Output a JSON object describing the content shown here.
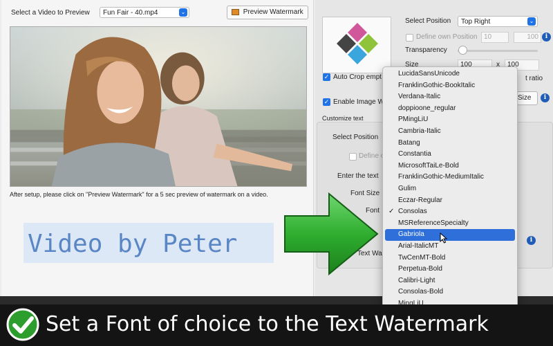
{
  "left_panel": {
    "select_video_label": "Select a Video to Preview",
    "video_file": "Fun Fair - 40.mp4",
    "preview_button": "Preview Watermark",
    "hint": "After setup, please click on \"Preview Watermark\" for a 5 sec preview of watermark on a video.",
    "watermark_text": "Video by Peter"
  },
  "image_settings": {
    "select_position_label": "Select Position",
    "position_value": "Top Right",
    "define_own_label": "Define own Position",
    "pos_x": "10",
    "pos_y": "100",
    "transparency_label": "Transparency",
    "transparency_value": 0,
    "size_label": "Size",
    "size_w": "100",
    "size_x": "x",
    "size_h": "100",
    "auto_crop_label": "Auto Crop empt",
    "ratio_label": "t ratio",
    "enable_image_label": "Enable Image W",
    "size_button": "Size"
  },
  "text_settings": {
    "section_label": "Customize text",
    "select_position_label": "Select Position",
    "define_label": "Define o",
    "enter_text_label": "Enter the text",
    "font_size_label": "Font Size",
    "font_label": "Font",
    "text_wm_label": "Text Wa"
  },
  "font_dropdown": {
    "items": [
      {
        "label": "LucidaSansUnicode",
        "checked": "",
        "selected": false
      },
      {
        "label": "FranklinGothic-BookItalic",
        "checked": "",
        "selected": false
      },
      {
        "label": "Verdana-Italic",
        "checked": "",
        "selected": false
      },
      {
        "label": "doppioone_regular",
        "checked": "",
        "selected": false
      },
      {
        "label": "PMingLiU",
        "checked": "",
        "selected": false
      },
      {
        "label": "Cambria-Italic",
        "checked": "",
        "selected": false
      },
      {
        "label": "Batang",
        "checked": "",
        "selected": false
      },
      {
        "label": "Constantia",
        "checked": "",
        "selected": false
      },
      {
        "label": "MicrosoftTaiLe-Bold",
        "checked": "",
        "selected": false
      },
      {
        "label": "FranklinGothic-MediumItalic",
        "checked": "",
        "selected": false
      },
      {
        "label": "Gulim",
        "checked": "",
        "selected": false
      },
      {
        "label": "Eczar-Regular",
        "checked": "",
        "selected": false
      },
      {
        "label": "Consolas",
        "checked": "✓",
        "selected": false
      },
      {
        "label": "MSReferenceSpecialty",
        "checked": "",
        "selected": false
      },
      {
        "label": "Gabriola",
        "checked": "",
        "selected": true
      },
      {
        "label": "Arial-ItalicMT",
        "checked": "",
        "selected": false
      },
      {
        "label": "TwCenMT-Bold",
        "checked": "",
        "selected": false
      },
      {
        "label": "Perpetua-Bold",
        "checked": "",
        "selected": false
      },
      {
        "label": "Calibri-Light",
        "checked": "",
        "selected": false
      },
      {
        "label": "Consolas-Bold",
        "checked": "",
        "selected": false
      },
      {
        "label": "MingLiU",
        "checked": "",
        "selected": false
      }
    ]
  },
  "banner": {
    "text": "Set a Font of choice to the Text Watermark"
  },
  "colors": {
    "accent": "#1f73e6",
    "highlight": "#2f6fda",
    "arrow_green": "#2fae2f",
    "watermark_blue": "#5a86c6"
  }
}
